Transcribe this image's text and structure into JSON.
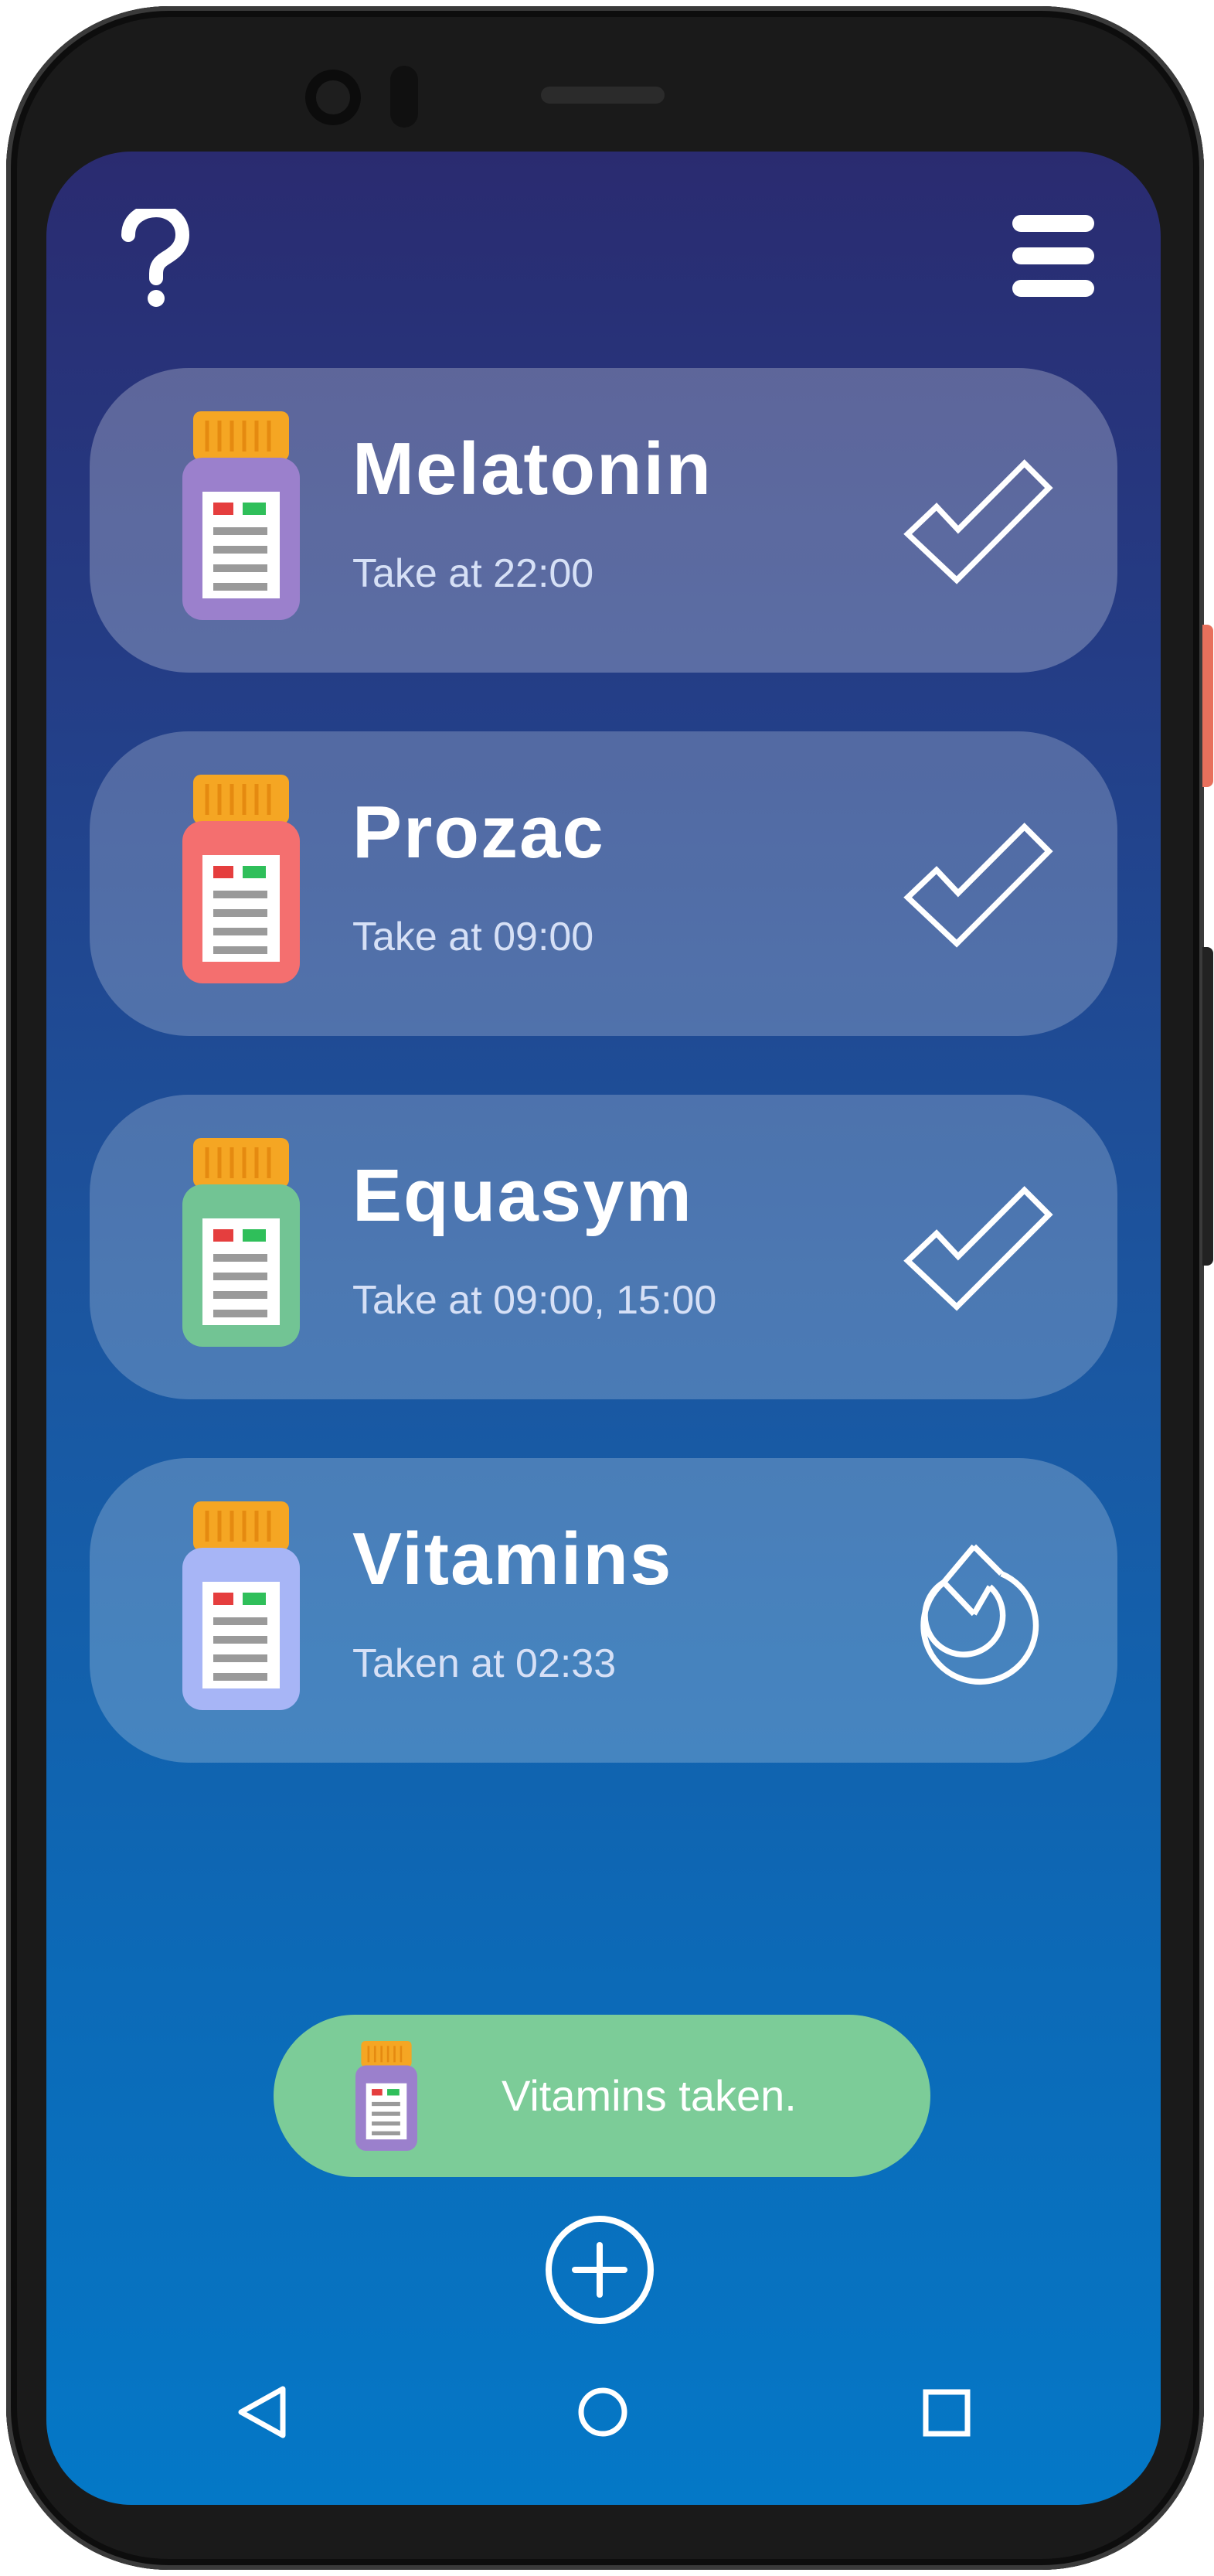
{
  "header": {
    "help_icon": "question-mark-icon",
    "menu_icon": "hamburger-menu-icon"
  },
  "medications": [
    {
      "name": "Melatonin",
      "schedule": "Take at 22:00",
      "bottle_color": "#9b80cc",
      "status_icon": "checkmark-icon",
      "card_bg": "rgba(255,255,255,0.25)"
    },
    {
      "name": "Prozac",
      "schedule": "Take at 09:00",
      "bottle_color": "#f46f6f",
      "status_icon": "checkmark-icon",
      "card_bg": "rgba(255,255,255,0.22)"
    },
    {
      "name": "Equasym",
      "schedule": "Take at 09:00, 15:00",
      "bottle_color": "#72c494",
      "status_icon": "checkmark-icon",
      "card_bg": "rgba(255,255,255,0.21)"
    },
    {
      "name": "Vitamins",
      "schedule": "Taken at 02:33",
      "bottle_color": "#a7b5f6",
      "status_icon": "undo-icon",
      "card_bg": "rgba(255,255,255,0.22)"
    }
  ],
  "toast": {
    "message": "Vitamins taken.",
    "bottle_color": "#9b80cc",
    "bg_color": "#7ccc98"
  },
  "add_button_icon": "plus-circle-icon",
  "navbar": {
    "back_icon": "back-triangle-icon",
    "home_icon": "home-circle-icon",
    "recents_icon": "recents-square-icon"
  },
  "colors": {
    "bottle_cap": "#f5a623",
    "label_red": "#e53e3e",
    "label_green": "#2fbf5a"
  }
}
